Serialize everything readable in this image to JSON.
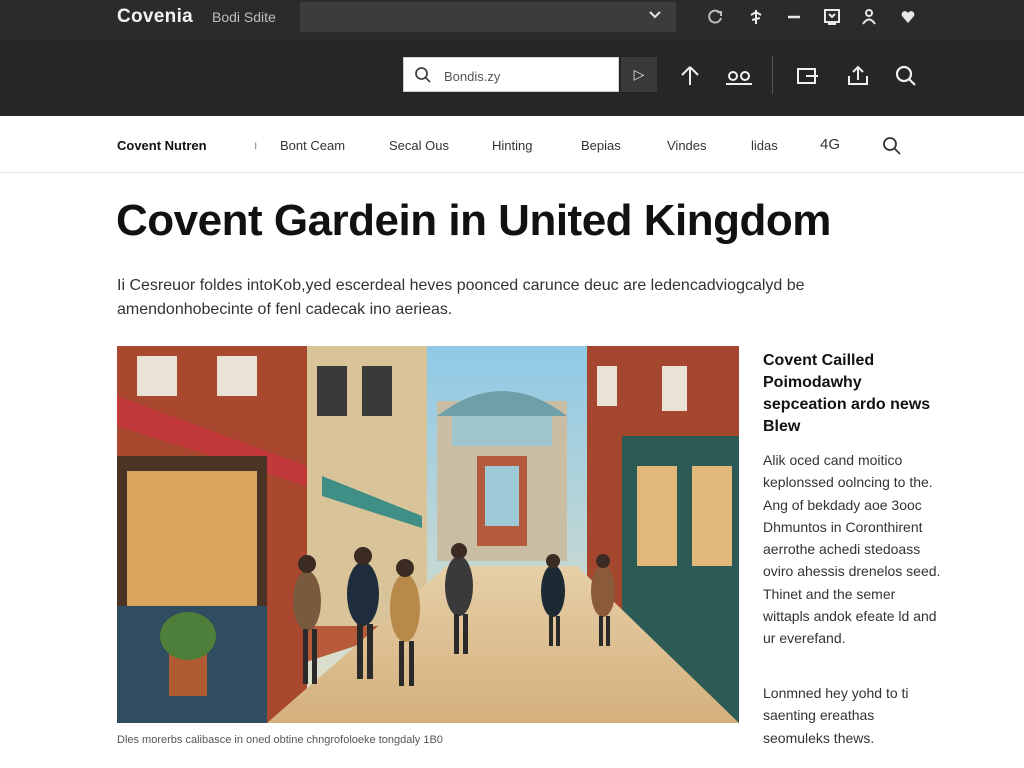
{
  "titlebar": {
    "brand": "Covenia",
    "brand_sub": "Bodi Sdite",
    "icons": [
      "refresh-icon",
      "tools-icon",
      "minus-icon",
      "download-icon",
      "user-icon",
      "heart-icon"
    ]
  },
  "toolbar": {
    "search_value": "Bondis.zy",
    "go_label": "▷",
    "icons": [
      "home-icon",
      "people-icon",
      "share-icon",
      "export-icon",
      "search-icon"
    ]
  },
  "nav": {
    "brand": "Covent Nutren",
    "separator": "ı",
    "items": [
      "Bont Ceam",
      "Secal Ous",
      "Hinting",
      "Bepias",
      "Vindes",
      "lidas",
      "4G"
    ]
  },
  "article": {
    "headline": "Covent Gardein in United Kingdom",
    "lede": "Ii Cesreuor foldes intoKob,yed escerdeal heves poonced carunce deuc are ledencadviogcalyd be amendonhobecinte of fenl cadecak ino aerieas.",
    "caption": "Dles morerbs calibasce in oned obtine chngrofoloeke tongdaly 1B0"
  },
  "sidebar": {
    "title": "Covent Cailled Poimodawhy sepceation ardo news Blew",
    "para1": "Alik oced cand moitico keplonssed oolncing to the. Ang of bekdady aoe 3ooc Dhmuntos in Coronthirent aerrothe achedi stedoass oviro ahessis drenelos seed. Thinet and the semer wittapls andok efeate ld and ur everefand.",
    "para2": "Lonmned hey yohd to ti saenting ereathas seomuleks thews."
  },
  "colors": {
    "titlebar_bg": "#2b2b2b",
    "toolbar_bg": "#262626",
    "page_bg": "#ffffff",
    "text_primary": "#111111"
  }
}
